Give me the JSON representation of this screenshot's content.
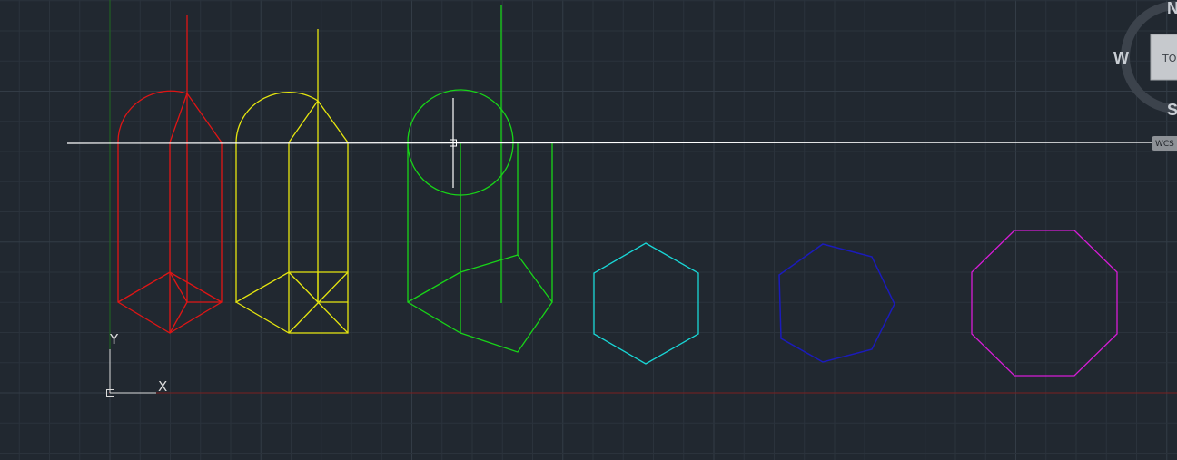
{
  "viewport": {
    "background": "#212830",
    "grid_color": "#2b333c",
    "grid_major_color": "#333c46"
  },
  "viewcube": {
    "north": "N",
    "west": "W",
    "south": "S",
    "face": "TO",
    "coordinate_system": "WCS"
  },
  "ucs_icon": {
    "x_label": "X",
    "y_label": "Y"
  },
  "colors": {
    "red": "#e01515",
    "yellow": "#e6e60f",
    "green": "#18d418",
    "cyan": "#19d7d7",
    "blue": "#1b1bbb",
    "magenta": "#d71cd7",
    "crosshair": "#ffffff",
    "x_axis": "#7a2020",
    "y_axis": "#1f6a1f"
  },
  "objects": [
    {
      "name": "red-prism",
      "icon": "square-pyramid-wireframe"
    },
    {
      "name": "yellow-prism",
      "icon": "box-wireframe"
    },
    {
      "name": "green-prism",
      "icon": "pentagon-prism-wireframe"
    },
    {
      "name": "cyan-hexagon",
      "icon": "hexagon"
    },
    {
      "name": "blue-heptagon",
      "icon": "heptagon"
    },
    {
      "name": "magenta-octagon",
      "icon": "octagon"
    }
  ]
}
